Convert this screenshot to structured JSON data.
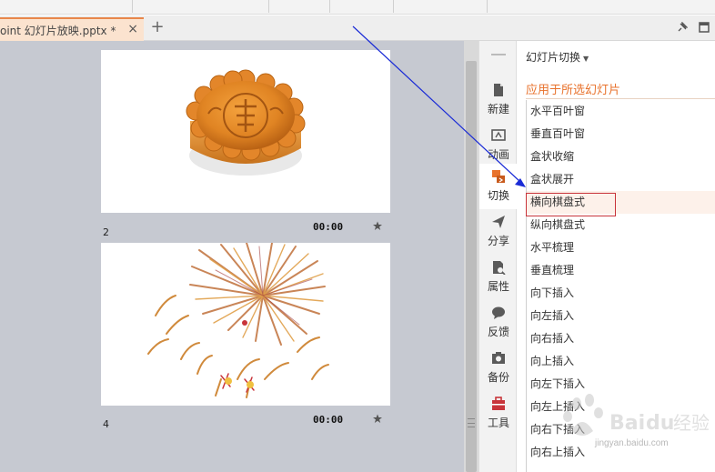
{
  "document_tab": {
    "title": "oint 幻灯片放映.pptx *",
    "close_glyph": "×"
  },
  "add_tab_glyph": "+",
  "slides": [
    {
      "number": "2",
      "time": "00:00",
      "image": "mooncake"
    },
    {
      "number": "4",
      "time": "00:00",
      "image": "fireworks"
    }
  ],
  "sidebar": {
    "items": [
      {
        "label": "新建",
        "icon": "new-doc-icon"
      },
      {
        "label": "动画",
        "icon": "animation-icon"
      },
      {
        "label": "切换",
        "icon": "transition-icon",
        "active": true
      },
      {
        "label": "分享",
        "icon": "share-icon"
      },
      {
        "label": "属性",
        "icon": "properties-icon"
      },
      {
        "label": "反馈",
        "icon": "feedback-icon"
      },
      {
        "label": "备份",
        "icon": "backup-icon"
      },
      {
        "label": "工具",
        "icon": "tools-icon"
      }
    ]
  },
  "panel": {
    "title": "幻灯片切换",
    "subtitle": "应用于所选幻灯片",
    "transitions": [
      "水平百叶窗",
      "垂直百叶窗",
      "盒状收缩",
      "盒状展开",
      "横向棋盘式",
      "纵向棋盘式",
      "水平梳理",
      "垂直梳理",
      "向下插入",
      "向左插入",
      "向右插入",
      "向上插入",
      "向左下插入",
      "向左上插入",
      "向右下插入",
      "向右上插入"
    ],
    "selected": "横向棋盘式"
  },
  "watermark": {
    "brand": "Bai du 经验",
    "url": "jingyan.baidu.com"
  },
  "colors": {
    "accent": "#e8722c",
    "highlight": "#c8343a",
    "arrow": "#1a2bd6"
  }
}
